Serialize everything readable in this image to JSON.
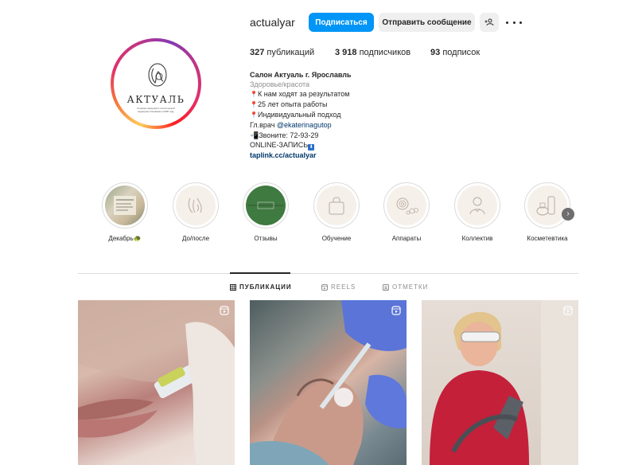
{
  "profile": {
    "username": "actualyar",
    "follow_label": "Подписаться",
    "message_label": "Отправить сообщение",
    "avatar_brand": "АКТУАЛЬ",
    "avatar_tagline": "Клиника лазерной и эстетической медицины Основана в 2000 году"
  },
  "stats": {
    "posts_count": "327",
    "posts_label": "публикаций",
    "followers_count": "3 918",
    "followers_label": "подписчиков",
    "following_count": "93",
    "following_label": "подписок"
  },
  "bio": {
    "name": "Салон Актуаль г. Ярославль",
    "category": "Здоровье/красота",
    "line1": "К нам ходят за результатом",
    "line2": "25 лет опыта работы",
    "line3": "Индивидуальный подход",
    "doctor_prefix": "Гл.врач ",
    "doctor_mention": "@ekaterinagutop",
    "phone_line": "Звоните: 72-93-29",
    "online_line": "ONLINE-ЗАПИСЬ",
    "link": "taplink.cc/actualyar"
  },
  "highlights": [
    {
      "label": "Декабрь🐢",
      "icon": "december-thumbnail"
    },
    {
      "label": "До/после",
      "icon": "face-icon"
    },
    {
      "label": "Отзывы",
      "icon": "reviews-thumbnail"
    },
    {
      "label": "Обучение",
      "icon": "bag-icon"
    },
    {
      "label": "Аппараты",
      "icon": "device-icon"
    },
    {
      "label": "Коллектив",
      "icon": "doctor-icon"
    },
    {
      "label": "Косметевтика",
      "icon": "cosmetics-icon"
    }
  ],
  "tabs": {
    "posts": "ПУБЛИКАЦИИ",
    "reels": "REELS",
    "tagged": "ОТМЕТКИ"
  },
  "colors": {
    "accent": "#0095f6",
    "link": "#00376b",
    "muted": "#8e8e8e"
  }
}
